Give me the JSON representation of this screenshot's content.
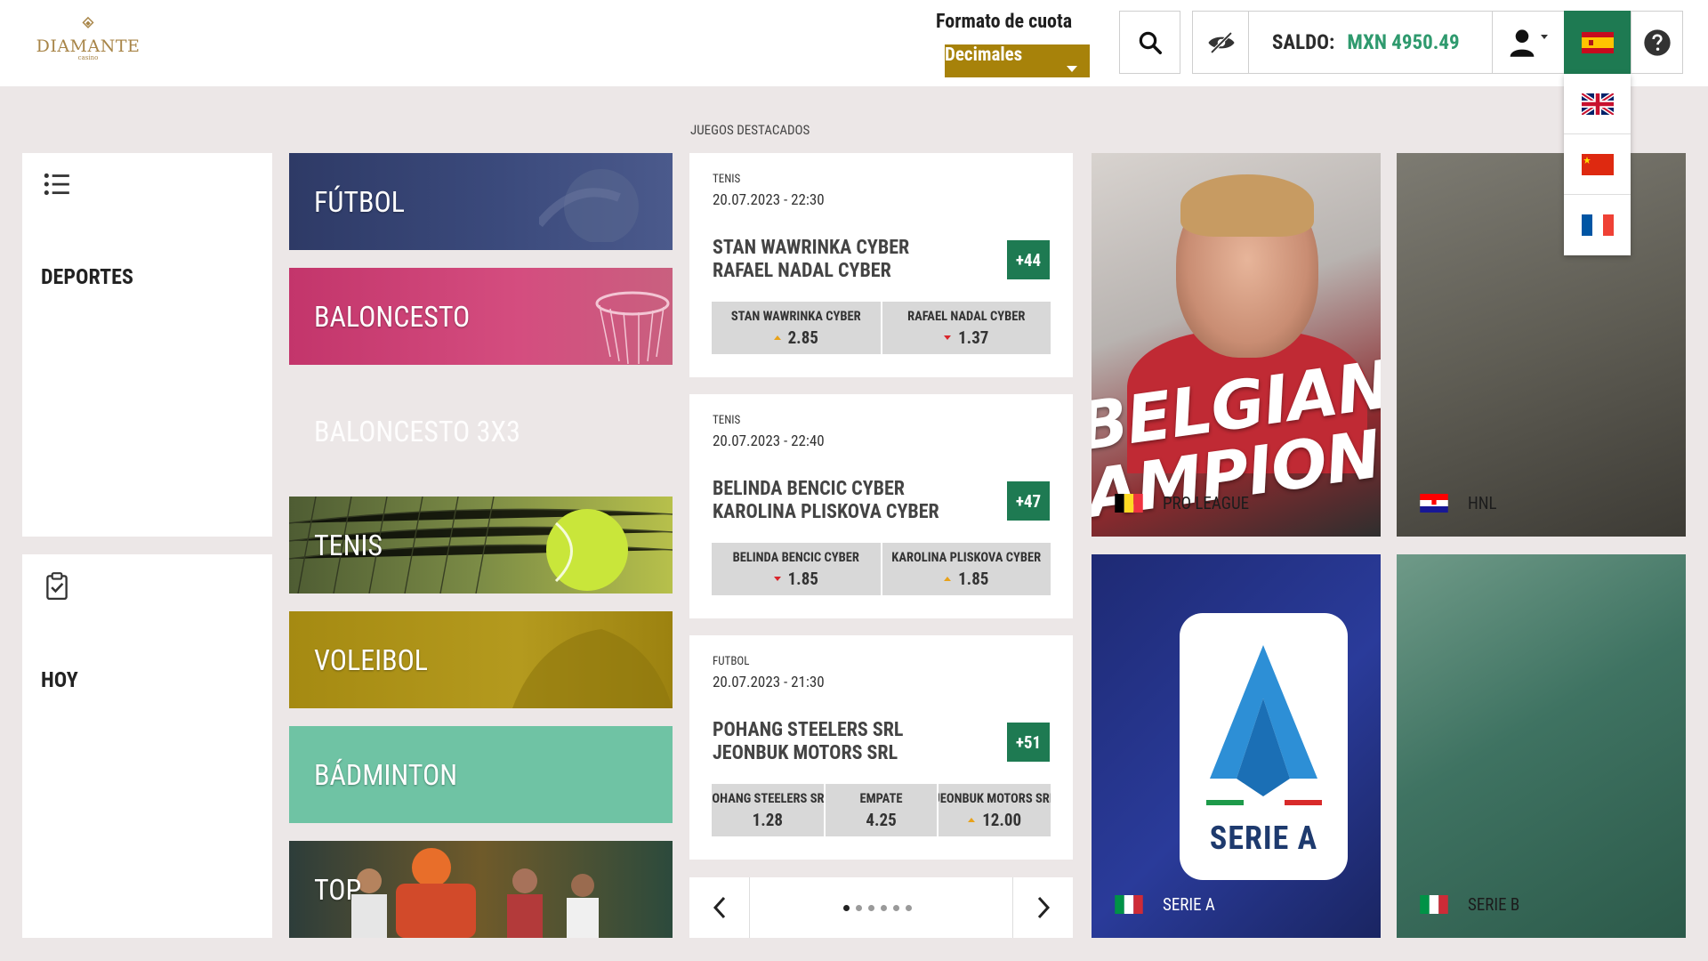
{
  "brand": {
    "name": "DIAMANTE",
    "sub": "casino"
  },
  "header": {
    "odds_format_label": "Formato de cuota",
    "odds_format_value": "Decimales",
    "balance_label": "SALDO:",
    "balance_value": "MXN 4950.49",
    "current_language": "es"
  },
  "languages": [
    "en",
    "cn",
    "fr"
  ],
  "sidebar": {
    "sports_label": "DEPORTES",
    "today_label": "HOY"
  },
  "sports": [
    {
      "label": "FÚTBOL"
    },
    {
      "label": "BALONCESTO"
    },
    {
      "label": "BALONCESTO 3X3"
    },
    {
      "label": "TENIS"
    },
    {
      "label": "VOLEIBOL"
    },
    {
      "label": "BÁDMINTON"
    },
    {
      "label": "TOP"
    }
  ],
  "featured": {
    "title": "JUEGOS DESTACADOS",
    "matches": [
      {
        "sport": "TENIS",
        "datetime": "20.07.2023 - 22:30",
        "team1": "STAN WAWRINKA CYBER",
        "team2": "RAFAEL NADAL CYBER",
        "more": "+44",
        "odds": [
          {
            "name": "STAN WAWRINKA CYBER",
            "value": "2.85",
            "trend": "up"
          },
          {
            "name": "RAFAEL NADAL CYBER",
            "value": "1.37",
            "trend": "down"
          }
        ]
      },
      {
        "sport": "TENIS",
        "datetime": "20.07.2023 - 22:40",
        "team1": "BELINDA BENCIC CYBER",
        "team2": "KAROLINA PLISKOVA CYBER",
        "more": "+47",
        "odds": [
          {
            "name": "BELINDA BENCIC CYBER",
            "value": "1.85",
            "trend": "down"
          },
          {
            "name": "KAROLINA PLISKOVA CYBER",
            "value": "1.85",
            "trend": "up"
          }
        ]
      },
      {
        "sport": "FUTBOL",
        "datetime": "20.07.2023 - 21:30",
        "team1": "POHANG STEELERS SRL",
        "team2": "JEONBUK MOTORS SRL",
        "more": "+51",
        "odds": [
          {
            "name": "POHANG STEELERS SRL",
            "value": "1.28",
            "trend": "none"
          },
          {
            "name": "EMPATE",
            "value": "4.25",
            "trend": "none"
          },
          {
            "name": "JEONBUK MOTORS SRL",
            "value": "12.00",
            "trend": "up"
          }
        ]
      }
    ],
    "pagination": {
      "pages": 6,
      "current": 1
    }
  },
  "leagues": [
    {
      "name": "PRO LEAGUE",
      "flag": "be",
      "banner_text": "BELGIAN\nCHAMPIONSHIP"
    },
    {
      "name": "HNL",
      "flag": "hr"
    },
    {
      "name": "SERIE A",
      "flag": "it",
      "logo_text": "SERIE A"
    },
    {
      "name": "SERIE B",
      "flag": "it"
    }
  ],
  "colors": {
    "accent_green": "#1e7a52",
    "gold": "#a7820a",
    "balance_green": "#2f9a6e",
    "page_bg": "#ece7e7"
  }
}
